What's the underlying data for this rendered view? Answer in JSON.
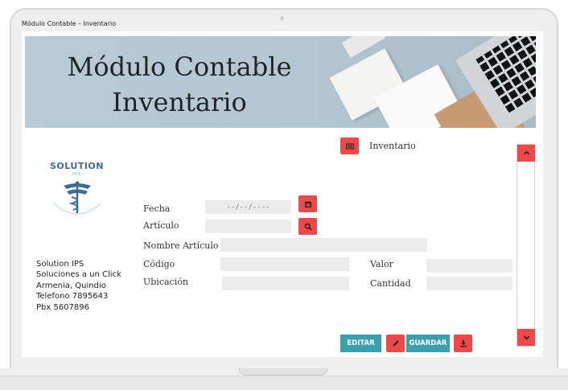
{
  "window": {
    "title": "Módulo Contable – Inventario"
  },
  "banner": {
    "title_line1": "Módulo Contable",
    "title_line2": "Inventario"
  },
  "logo": {
    "name": "SOLUTION",
    "sub": "IPS",
    "ring_text": "Soluciones en salud y administración de IPS"
  },
  "company": {
    "lines": [
      "Solution IPS",
      "Soluciones a un Click",
      "Armenia, Quindio",
      "Telefono 7895643",
      "Pbx 5607896"
    ]
  },
  "section": {
    "label": "Inventario",
    "icon": "id-card-icon"
  },
  "form": {
    "fecha_label": "Fecha",
    "fecha_value": "--/--/----",
    "articulo_label": "Artículo",
    "articulo_value": "",
    "nombre_label": "Nombre Artículo",
    "nombre_value": "",
    "codigo_label": "Código",
    "codigo_value": "",
    "ubicacion_label": "Ubicación",
    "ubicacion_value": "",
    "valor_label": "Valor",
    "valor_value": "",
    "cantidad_label": "Cantidad",
    "cantidad_value": ""
  },
  "toolbar": {
    "editar_label": "EDITAR",
    "guardar_label": "GUARDAR",
    "edit_icon": "pencil-icon",
    "download_icon": "download-icon"
  },
  "icons": {
    "calendar": "calendar-icon",
    "search": "search-icon",
    "up": "chevron-up-icon",
    "down": "chevron-down-icon"
  },
  "colors": {
    "accent_red": "#f04848",
    "accent_teal": "#3aa0ae",
    "field_bg": "#ececec",
    "logo_blue": "#3a6f95"
  }
}
